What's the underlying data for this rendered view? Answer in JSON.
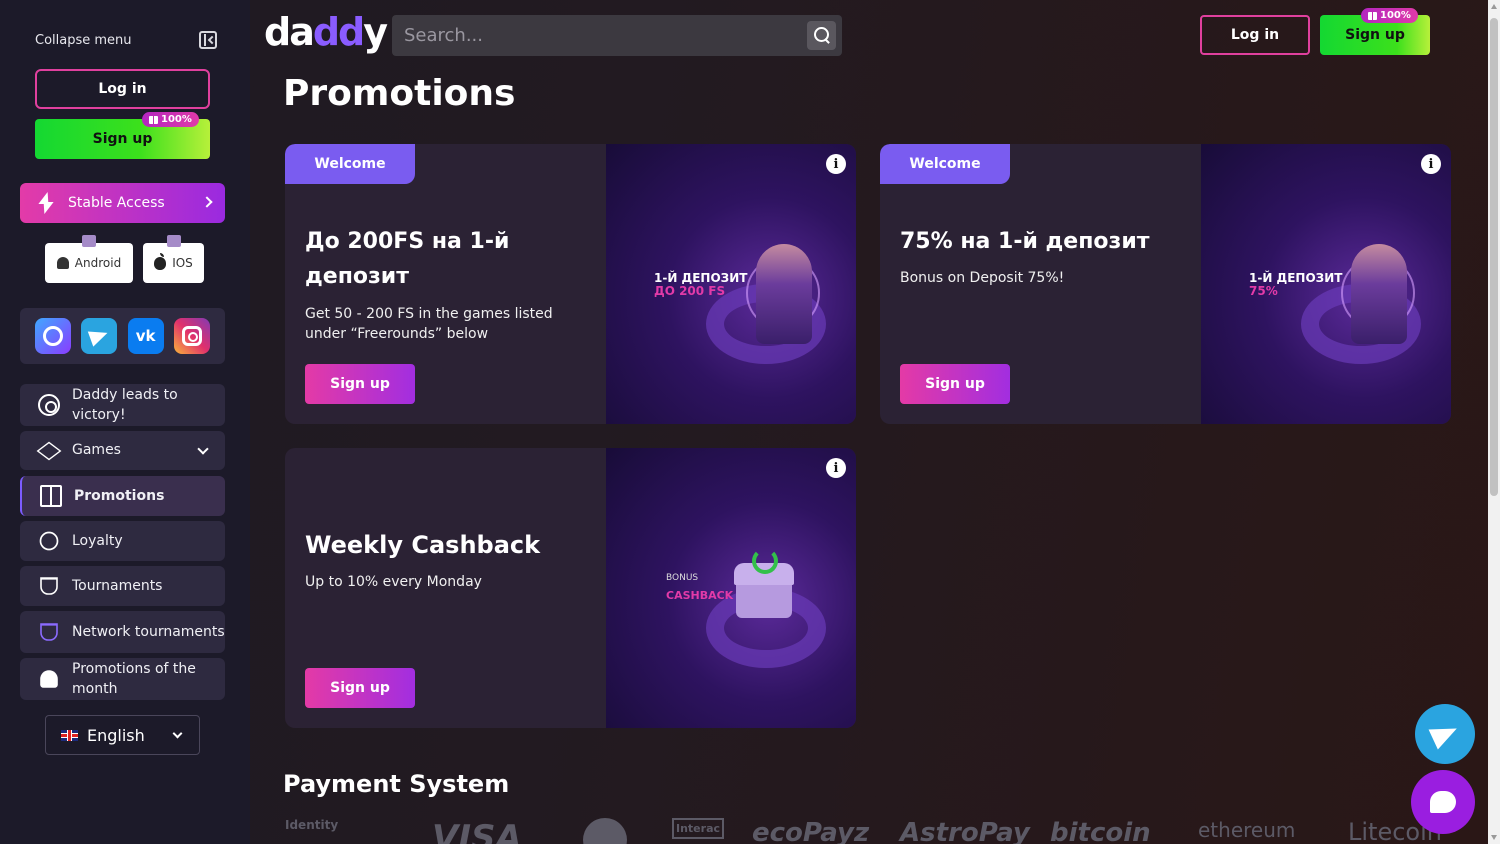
{
  "sidebar": {
    "collapse_label": "Collapse menu",
    "login_label": "Log in",
    "signup_label": "Sign up",
    "signup_badge": "100%",
    "stable_access_label": "Stable Access",
    "apps": [
      {
        "label": "Android",
        "icon": "android-icon"
      },
      {
        "label": "IOS",
        "icon": "apple-icon"
      }
    ],
    "socials": [
      "max-icon",
      "telegram-icon",
      "vk-icon",
      "instagram-icon"
    ],
    "vk_glyph": "vk",
    "nav": [
      {
        "label": "Daddy leads to victory!",
        "icon": "roulette-icon"
      },
      {
        "label": "Games",
        "icon": "diamond-icon"
      },
      {
        "label": "Promotions",
        "icon": "gift-icon",
        "active": true
      },
      {
        "label": "Loyalty",
        "icon": "medal-icon"
      },
      {
        "label": "Tournaments",
        "icon": "trophy-icon"
      },
      {
        "label": "Network tournaments",
        "icon": "trophy-purple-icon"
      },
      {
        "label": "Promotions of the month",
        "icon": "flower-icon"
      }
    ],
    "language": "English"
  },
  "header": {
    "logo_text_1": "da",
    "logo_text_2": "dd",
    "logo_text_3": "y",
    "search_placeholder": "Search...",
    "login_label": "Log in",
    "signup_label": "Sign up",
    "signup_badge": "100%"
  },
  "page": {
    "title": "Promotions"
  },
  "promotions": [
    {
      "tag": "Welcome",
      "title": "До 200FS на 1-й депозит",
      "description": "Get 50 - 200 FS in the games listed under “Freerounds” below",
      "button": "Sign up",
      "image_line1": "1-Й ДЕПОЗИТ",
      "image_line2": "ДО 200 FS"
    },
    {
      "tag": "Welcome",
      "title": "75% на 1-й депозит",
      "description": "Bonus on Deposit 75%!",
      "button": "Sign up",
      "image_line1": "1-Й ДЕПОЗИТ",
      "image_line2": "75%"
    },
    {
      "tag": "",
      "title": "Weekly Cashback",
      "description": "Up to 10% every Monday",
      "button": "Sign up",
      "image_line1": "BONUS",
      "image_line2": "CASHBACK"
    }
  ],
  "payment": {
    "title": "Payment System",
    "logos": [
      "Identity",
      "VISA",
      "",
      "Interac",
      "ecoPayz",
      "AstroPay",
      "bitcoin",
      "ethereum",
      "Litecoin"
    ]
  },
  "info_glyph": "i",
  "colors": {
    "accent_pink": "#e0409e",
    "accent_green": "#14d832",
    "accent_purple": "#7a5cf0",
    "sidebar_bg": "#1c1a29"
  }
}
